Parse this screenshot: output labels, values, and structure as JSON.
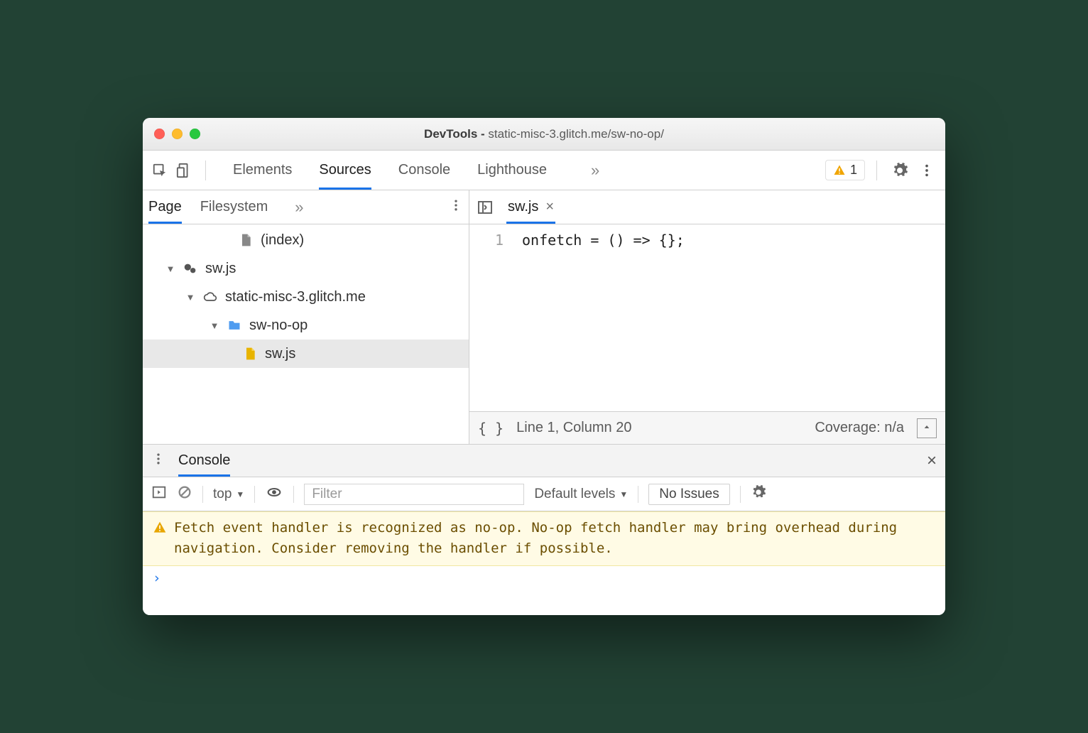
{
  "window": {
    "title_prefix": "DevTools - ",
    "title_main": "static-misc-3.glitch.me/sw-no-op/"
  },
  "main_tabs": {
    "elements": "Elements",
    "sources": "Sources",
    "console": "Console",
    "lighthouse": "Lighthouse"
  },
  "warning_count": "1",
  "sidebar": {
    "tabs": {
      "page": "Page",
      "filesystem": "Filesystem"
    },
    "tree": {
      "index": "(index)",
      "sw_worker": "sw.js",
      "domain": "static-misc-3.glitch.me",
      "folder": "sw-no-op",
      "file": "sw.js"
    }
  },
  "editor": {
    "tab_name": "sw.js",
    "line_number": "1",
    "code": "onfetch = () => {};",
    "status_position": "Line 1, Column 20",
    "status_coverage": "Coverage: n/a",
    "braces": "{ }"
  },
  "drawer": {
    "tab": "Console",
    "context": "top",
    "filter_placeholder": "Filter",
    "levels": "Default levels",
    "issues": "No Issues",
    "warning": "Fetch event handler is recognized as no-op. No-op fetch handler may bring overhead during navigation. Consider removing the handler if possible.",
    "prompt": "›"
  }
}
